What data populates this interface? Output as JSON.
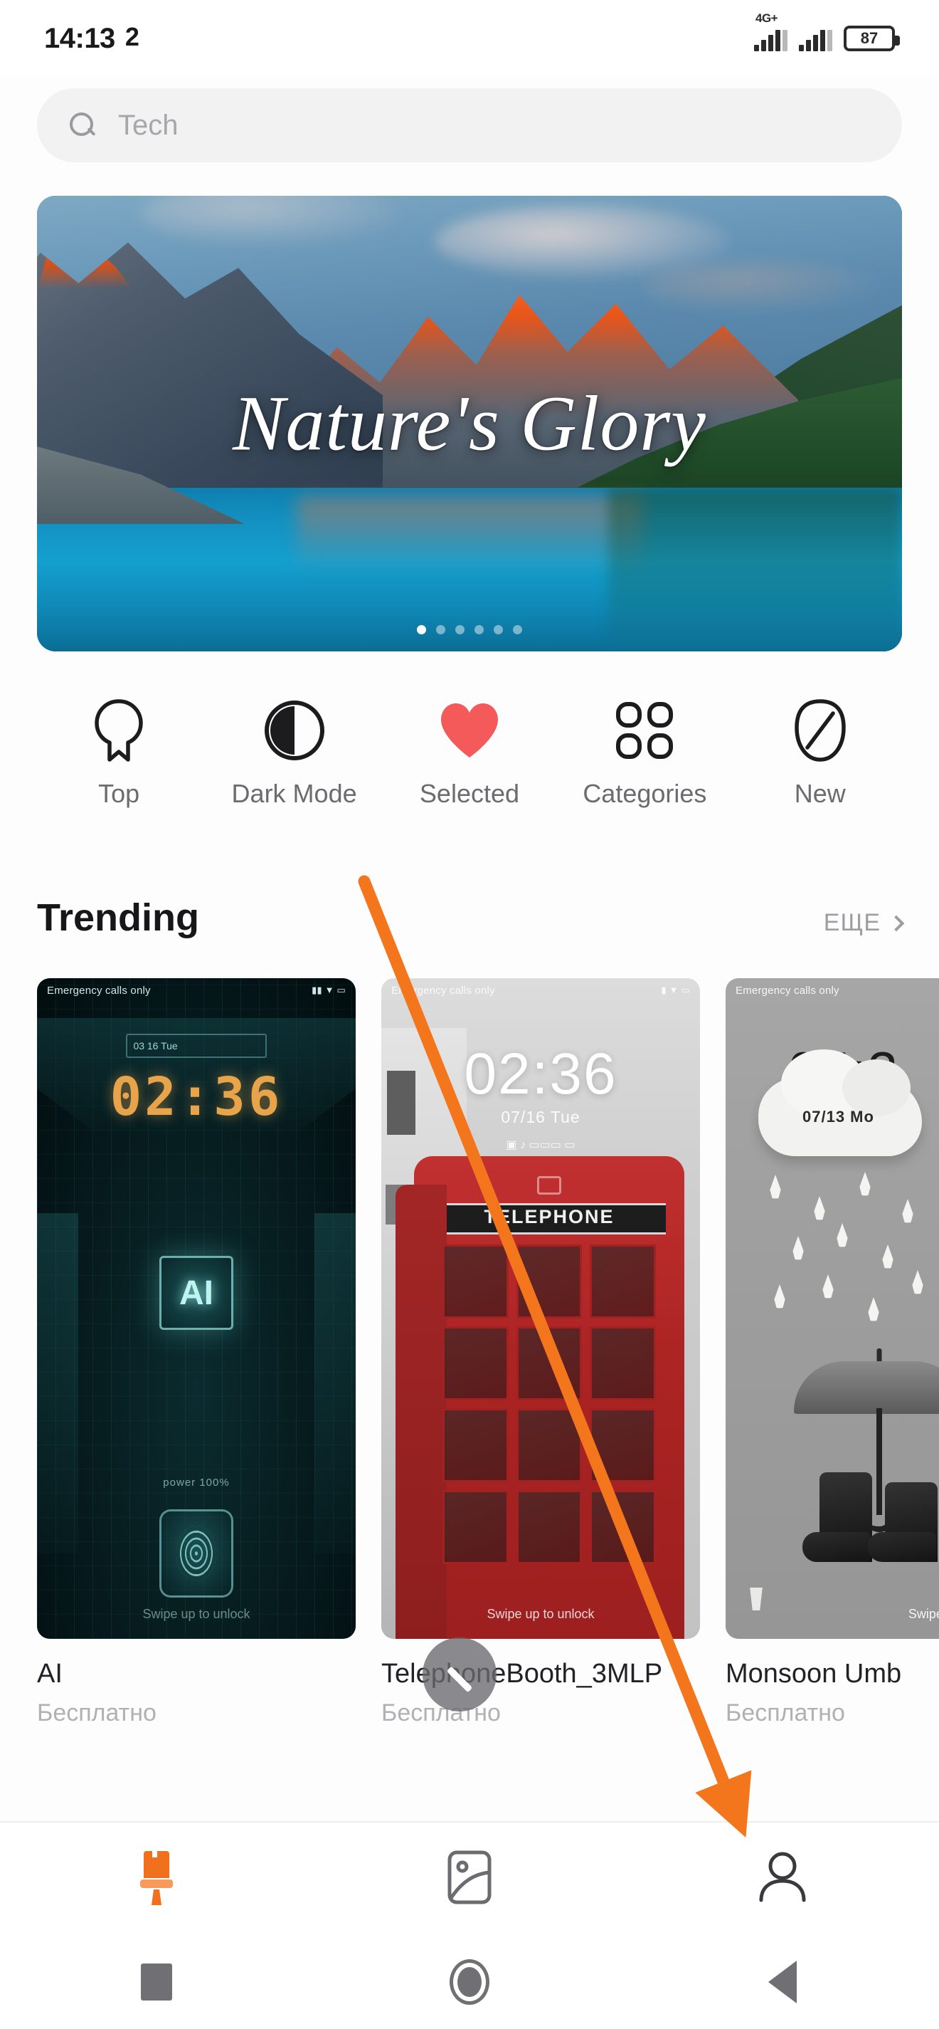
{
  "statusbar": {
    "time": "14:13",
    "alarm_badge": "2",
    "network_label": "4G+",
    "battery_level": "87"
  },
  "search": {
    "placeholder": "Tech",
    "icon": "search-icon"
  },
  "banner": {
    "title": "Nature's Glory",
    "slide_count": 6,
    "active_slide": 1
  },
  "categories": [
    {
      "label": "Top",
      "icon": "ribbon-badge-icon"
    },
    {
      "label": "Dark Mode",
      "icon": "half-moon-contrast-icon"
    },
    {
      "label": "Selected",
      "icon": "heart-icon"
    },
    {
      "label": "Categories",
      "icon": "grid-clover-icon"
    },
    {
      "label": "New",
      "icon": "leaf-icon"
    }
  ],
  "section": {
    "title": "Trending",
    "more_label": "ЕЩЕ",
    "more_icon": "chevron-right-icon"
  },
  "cards": [
    {
      "name": "AI",
      "price": "Бесплатно",
      "lock_status": "Emergency calls only",
      "clock": "02:36",
      "date": "03 16 Tue",
      "chip_label": "AI",
      "power_label": "power 100%",
      "swipe_hint": "Swipe up to unlock"
    },
    {
      "name": "TelephoneBooth_3MLP",
      "price": "Бесплатно",
      "lock_status": "Emergency calls only",
      "clock": "02:36",
      "date": "07/16 Tue",
      "booth_sign": "TELEPHONE",
      "swipe_hint": "Swipe up to unlock"
    },
    {
      "name": "Monsoon Umb",
      "price": "Бесплатно",
      "lock_status": "Emergency calls only",
      "clock": "05:3",
      "date": "07/13 Mo",
      "swipe_hint": "Swipe up to unlock"
    }
  ],
  "fab": {
    "icon": "scroll-to-top-icon"
  },
  "tabbar": [
    {
      "icon": "paint-brush-icon",
      "active": true,
      "color": "#f0701e"
    },
    {
      "icon": "wallpaper-image-icon",
      "active": false,
      "color": "#6b6b70"
    },
    {
      "icon": "person-profile-icon",
      "active": false,
      "color": "#3a3a3e"
    }
  ],
  "navbar": [
    {
      "icon": "recents-square-icon"
    },
    {
      "icon": "home-circle-icon"
    },
    {
      "icon": "back-triangle-icon"
    }
  ],
  "annotation": {
    "arrow_color": "#f4761c",
    "points_to": "person-profile-icon"
  }
}
